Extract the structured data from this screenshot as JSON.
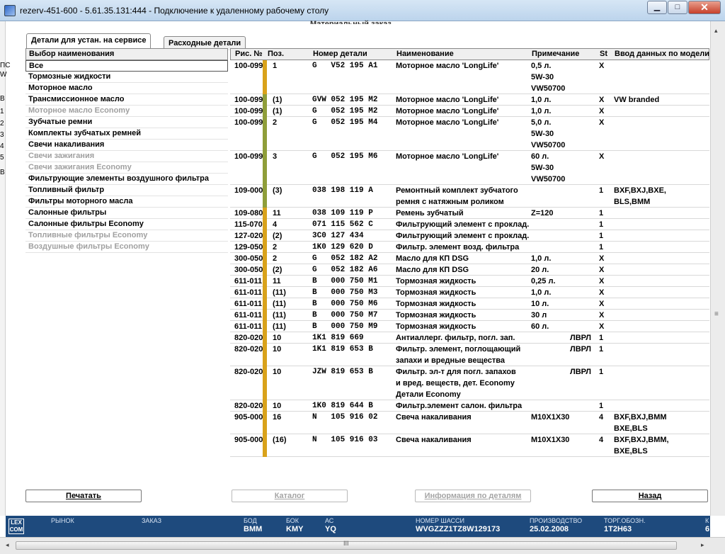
{
  "window": {
    "title": "rezerv-451-600 - 5.61.35.131:444 - Подключение к удаленному рабочему столу",
    "minimize": "▁",
    "maximize": "□",
    "close": "✕"
  },
  "subtitle": "Материальный заказ",
  "left_fragments": [
    "ПС",
    "W",
    "В",
    "1",
    "2",
    "3",
    "4",
    "5",
    "В"
  ],
  "tabs": [
    "Детали для устан. на сервисе",
    "Расходные детали"
  ],
  "category_list": {
    "header": "Выбор наименования",
    "items": [
      {
        "label": "Все",
        "enabled": true,
        "selected": true
      },
      {
        "label": "Тормозные жидкости",
        "enabled": true
      },
      {
        "label": "Моторное масло",
        "enabled": true
      },
      {
        "label": "Трансмиссионное масло",
        "enabled": true
      },
      {
        "label": "Моторное масло Economy",
        "enabled": false
      },
      {
        "label": "Зубчатые ремни",
        "enabled": true
      },
      {
        "label": "Комплекты зубчатых ремней",
        "enabled": true
      },
      {
        "label": "Свечи накаливания",
        "enabled": true
      },
      {
        "label": "Свечи зажигания",
        "enabled": false
      },
      {
        "label": "Свечи зажигания Economy",
        "enabled": false
      },
      {
        "label": "Фильтрующие элементы воздушного фильтра",
        "enabled": true
      },
      {
        "label": "Топливный фильтр",
        "enabled": true
      },
      {
        "label": "Фильтры моторного масла",
        "enabled": true
      },
      {
        "label": "Салонные фильтры",
        "enabled": true
      },
      {
        "label": "Салонные фильтры Economy",
        "enabled": true
      },
      {
        "label": "Топливные фильтры Economy",
        "enabled": false
      },
      {
        "label": "Воздушные фильтры Economy",
        "enabled": false
      }
    ]
  },
  "table": {
    "columns": [
      "Рис. №",
      "Поз.",
      "Номер детали",
      "Наименование",
      "Примечание",
      "St",
      "Ввод данных по модели"
    ],
    "colors": {
      "orange": "#d9a21b",
      "green": "#8f9e3a"
    },
    "rows": [
      {
        "fig": "100-099",
        "pos": "1",
        "part": "G   V52 195 A1",
        "name": [
          "Моторное масло 'LongLife'"
        ],
        "note": [
          "0,5 л.",
          "5W-30",
          "VW50700"
        ],
        "note2": "",
        "st": "X",
        "model": [],
        "bar": "orange"
      },
      {
        "fig": "100-099",
        "pos": "(1)",
        "part": "GVW 052 195 M2",
        "name": [
          "Моторное масло 'LongLife'"
        ],
        "note": [
          "1,0 л."
        ],
        "note2": "",
        "st": "X",
        "model": [
          "VW branded"
        ],
        "bar": "green"
      },
      {
        "fig": "100-099",
        "pos": "(1)",
        "part": "G   052 195 M2",
        "name": [
          "Моторное масло 'LongLife'"
        ],
        "note": [
          "1,0 л."
        ],
        "note2": "",
        "st": "X",
        "model": [],
        "bar": "green"
      },
      {
        "fig": "100-099",
        "pos": "2",
        "part": "G   052 195 M4",
        "name": [
          "Моторное масло 'LongLife'"
        ],
        "note": [
          "5,0 л.",
          "5W-30",
          "VW50700"
        ],
        "note2": "",
        "st": "X",
        "model": [],
        "bar": "green"
      },
      {
        "fig": "100-099",
        "pos": "3",
        "part": "G   052 195 M6",
        "name": [
          "Моторное масло 'LongLife'"
        ],
        "note": [
          "60 л.",
          "5W-30",
          "VW50700"
        ],
        "note2": "",
        "st": "X",
        "model": [],
        "bar": "green"
      },
      {
        "fig": "109-000",
        "pos": "(3)",
        "part": "038 198 119 A",
        "name": [
          "Ремонтный комплект зубчатого",
          "ремня с натяжным роликом"
        ],
        "note": [],
        "note2": "",
        "st": "1",
        "model": [
          "BXF,BXJ,BXE,",
          "BLS,BMM"
        ],
        "bar": "green"
      },
      {
        "fig": "109-080",
        "pos": "11",
        "part": "038 109 119 P",
        "name": [
          "Ремень зубчатый"
        ],
        "note": [
          "Z=120"
        ],
        "note2": "",
        "st": "1",
        "model": [],
        "bar": "orange"
      },
      {
        "fig": "115-070",
        "pos": "4",
        "part": "071 115 562 C",
        "name": [
          "Фильтрующий элемент с проклад."
        ],
        "note": [],
        "note2": "",
        "st": "1",
        "model": [],
        "bar": "orange"
      },
      {
        "fig": "127-020",
        "pos": "(2)",
        "part": "3C0 127 434",
        "name": [
          "Фильтрующий элемент с проклад."
        ],
        "note": [],
        "note2": "",
        "st": "1",
        "model": [],
        "bar": "orange"
      },
      {
        "fig": "129-050",
        "pos": "2",
        "part": "1K0 129 620 D",
        "name": [
          "Фильтр. элемент возд. фильтра"
        ],
        "note": [],
        "note2": "",
        "st": "1",
        "model": [],
        "bar": "orange"
      },
      {
        "fig": "300-050",
        "pos": "2",
        "part": "G   052 182 A2",
        "name": [
          "Масло для КП DSG"
        ],
        "note": [
          "1,0 л."
        ],
        "note2": "",
        "st": "X",
        "model": [],
        "bar": "orange"
      },
      {
        "fig": "300-050",
        "pos": "(2)",
        "part": "G   052 182 A6",
        "name": [
          "Масло для КП DSG"
        ],
        "note": [
          "20 л."
        ],
        "note2": "",
        "st": "X",
        "model": [],
        "bar": "orange"
      },
      {
        "fig": "611-011",
        "pos": "11",
        "part": "B   000 750 M1",
        "name": [
          "Тормозная жидкость"
        ],
        "note": [
          "0,25 л."
        ],
        "note2": "",
        "st": "X",
        "model": [],
        "bar": "orange"
      },
      {
        "fig": "611-011",
        "pos": "(11)",
        "part": "B   000 750 M3",
        "name": [
          "Тормозная жидкость"
        ],
        "note": [
          "1,0 л."
        ],
        "note2": "",
        "st": "X",
        "model": [],
        "bar": "orange"
      },
      {
        "fig": "611-011",
        "pos": "(11)",
        "part": "B   000 750 M6",
        "name": [
          "Тормозная жидкость"
        ],
        "note": [
          "10 л."
        ],
        "note2": "",
        "st": "X",
        "model": [],
        "bar": "orange"
      },
      {
        "fig": "611-011",
        "pos": "(11)",
        "part": "B   000 750 M7",
        "name": [
          "Тормозная жидкость"
        ],
        "note": [
          "30 л"
        ],
        "note2": "",
        "st": "X",
        "model": [],
        "bar": "orange"
      },
      {
        "fig": "611-011",
        "pos": "(11)",
        "part": "B   000 750 M9",
        "name": [
          "Тормозная жидкость"
        ],
        "note": [
          "60 л."
        ],
        "note2": "",
        "st": "X",
        "model": [],
        "bar": "orange"
      },
      {
        "fig": "820-020",
        "pos": "10",
        "part": "1K1 819 669",
        "name": [
          "Антиаллерг. фильтр, погл. зап."
        ],
        "note": [],
        "note2": "ЛВРЛ",
        "st": "1",
        "model": [],
        "bar": "orange"
      },
      {
        "fig": "820-020",
        "pos": "10",
        "part": "1K1 819 653 B",
        "name": [
          "Фильтр. элемент, поглощающий",
          "запахи и вредные вещества"
        ],
        "note": [],
        "note2": "ЛВРЛ",
        "st": "1",
        "model": [],
        "bar": "orange"
      },
      {
        "fig": "820-020",
        "pos": "10",
        "part": "JZW 819 653 B",
        "name": [
          "Фильтр. эл-т для погл. запахов",
          "и вред. веществ, дет. Economy",
          "Детали Economy"
        ],
        "note": [],
        "note2": "ЛВРЛ",
        "st": "1",
        "model": [],
        "bar": "orange"
      },
      {
        "fig": "820-020",
        "pos": "10",
        "part": "1K0 819 644 B",
        "name": [
          "Фильтр.элемент салон. фильтра"
        ],
        "note": [],
        "note2": "",
        "st": "1",
        "model": [],
        "bar": "orange"
      },
      {
        "fig": "905-000",
        "pos": "16",
        "part": "N   105 916 02",
        "name": [
          "Свеча накаливания"
        ],
        "note": [
          "M10X1X30"
        ],
        "note2": "",
        "st": "4",
        "model": [
          "BXF,BXJ,BMM",
          "BXE,BLS"
        ],
        "bar": "orange"
      },
      {
        "fig": "905-000",
        "pos": "(16)",
        "part": "N   105 916 03",
        "name": [
          "Свеча накаливания"
        ],
        "note": [
          "M10X1X30"
        ],
        "note2": "",
        "st": "4",
        "model": [
          "BXF,BXJ,BMM,",
          "BXE,BLS"
        ],
        "bar": "orange"
      }
    ]
  },
  "buttons": {
    "print": "Печатать",
    "catalog": "Каталог",
    "info": "Информация по деталям",
    "back": "Назад"
  },
  "statusbar": {
    "logo": "LEX COM",
    "fields": [
      {
        "label": "РЫНОК",
        "value": ""
      },
      {
        "label": "ЗАКАЗ",
        "value": ""
      },
      {
        "label": "БОД",
        "value": "BMM"
      },
      {
        "label": "БОК",
        "value": "KMY"
      },
      {
        "label": "АС",
        "value": "YQ"
      },
      {
        "label": "НОМЕР ШАССИ",
        "value": "WVGZZZ1TZ8W129173"
      },
      {
        "label": "ПРОИЗВОДСТВО",
        "value": "25.02.2008"
      },
      {
        "label": "ТОРГ.ОБОЗН.",
        "value": "1T2H63"
      },
      {
        "label": "К",
        "value": "6"
      }
    ]
  },
  "scroll": {
    "grip": "III",
    "left": "◂",
    "right": "▸",
    "up": "▴",
    "side_grip": "≡"
  }
}
